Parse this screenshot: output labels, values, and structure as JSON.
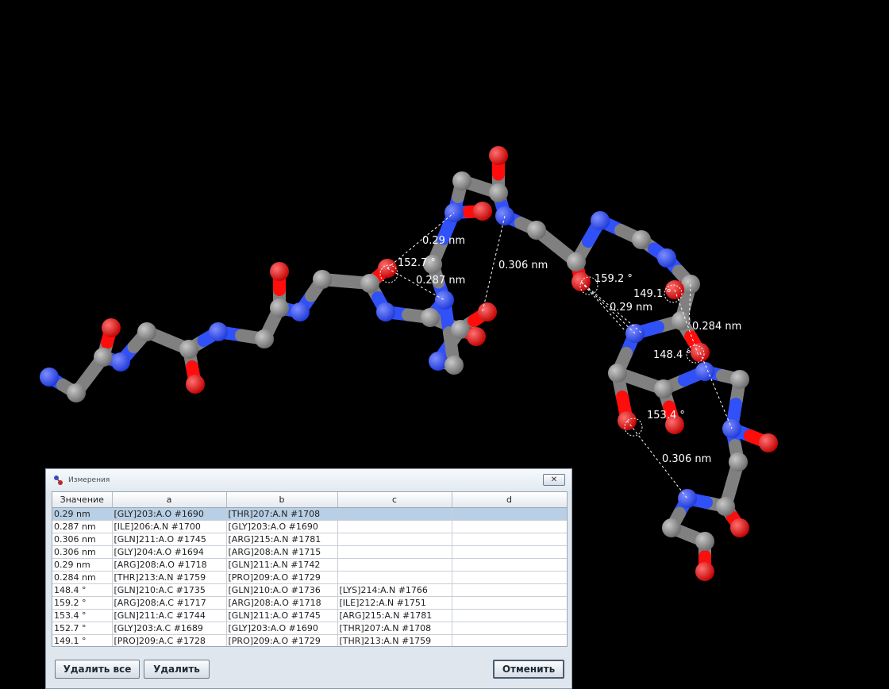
{
  "viewer": {
    "labels": {
      "d1": "0.29 nm",
      "a1": "152.7 °",
      "d2": "0.287 nm",
      "d3": "0.306 nm",
      "a2": "159.2 °",
      "a3": "149.1 °",
      "d4": "0.29 nm",
      "d5": "0.284 nm",
      "a4": "148.4 °",
      "a5": "153.4 °",
      "d6": "0.306 nm"
    },
    "atom_colors": {
      "carbon": "#808080",
      "nitrogen": "#3050f8",
      "oxygen": "#ff0d0d"
    }
  },
  "dialog": {
    "title": "Измерения",
    "icon": "measure-icon",
    "close_glyph": "✕",
    "columns": [
      "Значение",
      "a",
      "b",
      "c",
      "d"
    ],
    "rows": [
      [
        "0.29 nm",
        "[GLY]203:A.O #1690",
        "[THR]207:A.N #1708",
        "",
        ""
      ],
      [
        "0.287 nm",
        "[ILE]206:A.N #1700",
        "[GLY]203:A.O #1690",
        "",
        ""
      ],
      [
        "0.306 nm",
        "[GLN]211:A.O #1745",
        "[ARG]215:A.N #1781",
        "",
        ""
      ],
      [
        "0.306 nm",
        "[GLY]204:A.O #1694",
        "[ARG]208:A.N #1715",
        "",
        ""
      ],
      [
        "0.29 nm",
        "[ARG]208:A.O #1718",
        "[GLN]211:A.N #1742",
        "",
        ""
      ],
      [
        "0.284 nm",
        "[THR]213:A.N #1759",
        "[PRO]209:A.O #1729",
        "",
        ""
      ],
      [
        "148.4 °",
        "[GLN]210:A.C #1735",
        "[GLN]210:A.O #1736",
        "[LYS]214:A.N #1766",
        ""
      ],
      [
        "159.2 °",
        "[ARG]208:A.C #1717",
        "[ARG]208:A.O #1718",
        "[ILE]212:A.N #1751",
        ""
      ],
      [
        "153.4 °",
        "[GLN]211:A.C #1744",
        "[GLN]211:A.O #1745",
        "[ARG]215:A.N #1781",
        ""
      ],
      [
        "152.7 °",
        "[GLY]203:A.C #1689",
        "[GLY]203:A.O #1690",
        "[THR]207:A.N #1708",
        ""
      ],
      [
        "149.1 °",
        "[PRO]209:A.C #1728",
        "[PRO]209:A.O #1729",
        "[THR]213:A.N #1759",
        ""
      ]
    ],
    "selected_row": 0,
    "buttons": {
      "delete_all": "Удалить все",
      "delete": "Удалить",
      "cancel": "Отменить"
    }
  }
}
